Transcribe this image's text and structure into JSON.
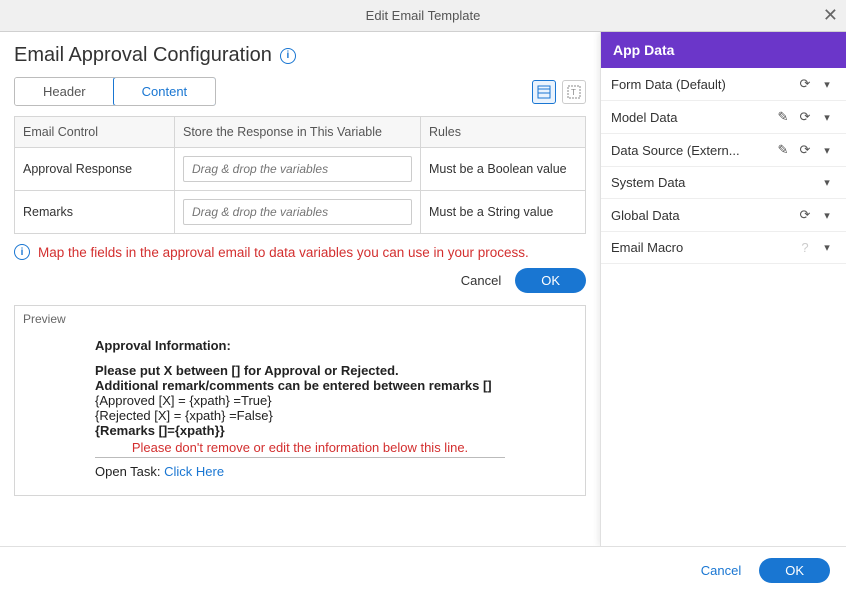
{
  "modal": {
    "title": "Edit Email Template"
  },
  "section": {
    "title": "Email Approval Configuration"
  },
  "tabs": {
    "header": "Header",
    "content": "Content"
  },
  "grid": {
    "cols": {
      "c0": "Email Control",
      "c1": "Store the Response in This Variable",
      "c2": "Rules"
    },
    "r0": {
      "label": "Approval Response",
      "placeholder": "Drag & drop the variables",
      "rule": "Must be a Boolean value"
    },
    "r1": {
      "label": "Remarks",
      "placeholder": "Drag & drop the variables",
      "rule": "Must be a String value"
    }
  },
  "hint": "Map the fields in the approval email to data variables you can use in your process.",
  "innerActions": {
    "cancel": "Cancel",
    "ok": "OK"
  },
  "preview": {
    "label": "Preview",
    "h1": "Approval Information:",
    "l1": "Please put X between [] for Approval or Rejected.",
    "l2": "Additional remark/comments can be entered between remarks []",
    "l3": "{Approved [X] = {xpath} =True}",
    "l4": "{Rejected [X] = {xpath} =False}",
    "l5": "{Remarks []={xpath}}",
    "warn": "Please don't remove or edit the information below this line.",
    "task_prefix": "Open Task: ",
    "task_link": "Click Here"
  },
  "panel": {
    "title": "App Data",
    "items": {
      "i0": "Form Data (Default)",
      "i1": "Model Data",
      "i2": "Data Source (Extern...",
      "i3": "System Data",
      "i4": "Global Data",
      "i5": "Email Macro"
    }
  },
  "footer": {
    "cancel": "Cancel",
    "ok": "OK"
  }
}
